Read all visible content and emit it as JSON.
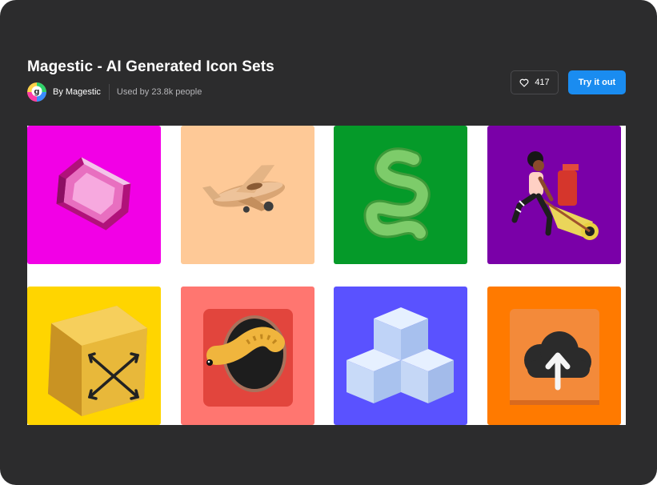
{
  "header": {
    "title": "Magestic - AI Generated Icon Sets",
    "author": "By Magestic",
    "usage": "Used by 23.8k people"
  },
  "actions": {
    "likes": "417",
    "try_label": "Try it out"
  },
  "colors": {
    "accent": "#1a8cf0",
    "background": "#2c2c2d"
  },
  "gallery": {
    "tiles": [
      {
        "icon": "pink-gem-icon",
        "background": "#f200e6"
      },
      {
        "icon": "wooden-airplane-icon",
        "background": "#fec997"
      },
      {
        "icon": "green-squiggle-icon",
        "background": "#059a29"
      },
      {
        "icon": "character-pushing-cart-icon",
        "background": "#7a00a8"
      },
      {
        "icon": "yellow-box-arrows-icon",
        "background": "#ffd500"
      },
      {
        "icon": "worm-hole-icon",
        "background": "#ff7670"
      },
      {
        "icon": "glass-cubes-icon",
        "background": "#5a52ff"
      },
      {
        "icon": "cloud-upload-icon",
        "background": "#ff7a00"
      }
    ]
  }
}
